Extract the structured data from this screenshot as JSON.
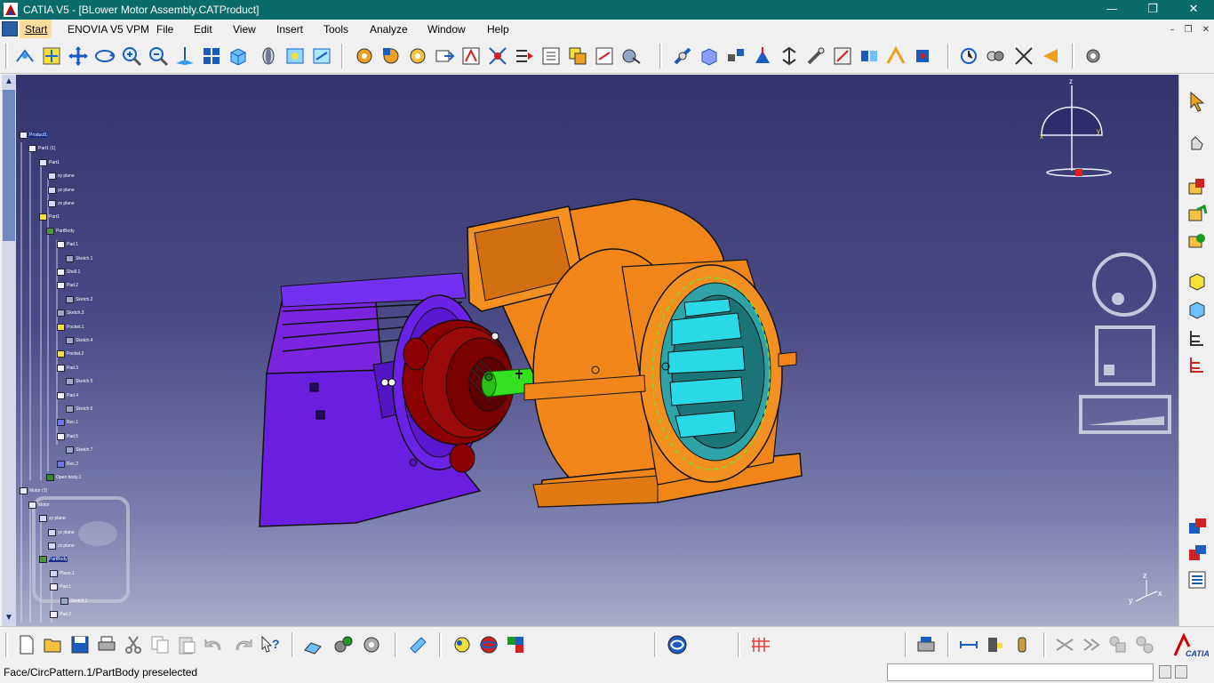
{
  "window": {
    "title": "CATIA V5 - [BLower Motor Assembly.CATProduct]",
    "minimize": "—",
    "restore": "❐",
    "close": "✕"
  },
  "menu": {
    "items": [
      "Start",
      "ENOVIA V5 VPM",
      "File",
      "Edit",
      "View",
      "Insert",
      "Tools",
      "Analyze",
      "Window",
      "Help"
    ]
  },
  "status": {
    "message": "Face/CircPattern.1/PartBody preselected",
    "command_placeholder": ""
  },
  "compass": {
    "axes": [
      "x",
      "y",
      "z"
    ]
  },
  "triad": {
    "x": "x",
    "y": "y",
    "z": "z"
  },
  "tree": {
    "nodes": [
      "Product1",
      "Part1 (1)",
      "Part1",
      "xy plane",
      "yz plane",
      "zx plane",
      "Part1",
      "PartBody",
      "Pad.1",
      "Sketch.1",
      "Shell.1",
      "Pad.2",
      "Sketch.2",
      "Sketch.3",
      "Pocket.1",
      "Sketch.4",
      "Pocket.2",
      "Pad.3",
      "Sketch.5",
      "Pad.4",
      "Sketch.6",
      "Rec.1",
      "Pad.5",
      "Sketch.7",
      "Rec.2",
      "Open body.1",
      "Motor (1)",
      "Motor",
      "xy plane",
      "yz plane",
      "zx plane",
      "PartBody",
      "Plane.1",
      "Pad.1",
      "Sketch.1",
      "Pad.2"
    ]
  },
  "colors": {
    "title_bar": "#0a6b6a",
    "viewport_top": "#34346e",
    "viewport_bottom": "#a9acca",
    "motor": "#7a24e0",
    "blower": "#f08a10",
    "shaft": "#36e020",
    "rotor": "#8b0000",
    "fins": "#29d9e6"
  }
}
